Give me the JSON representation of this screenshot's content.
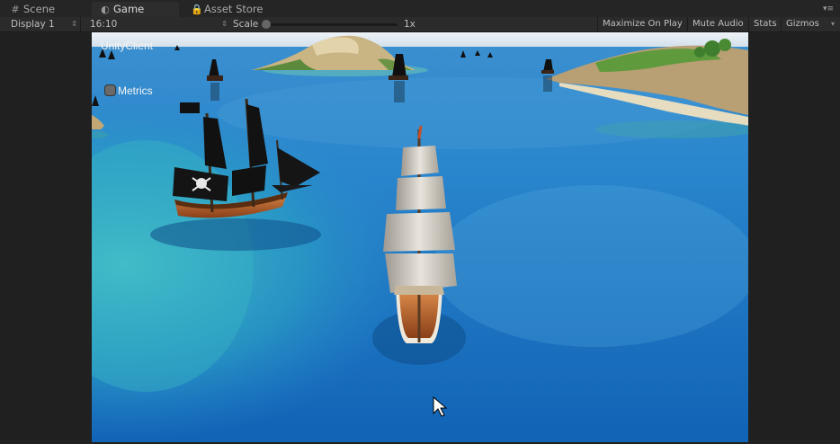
{
  "tabs": [
    {
      "label": "Scene",
      "icon": "grid-icon"
    },
    {
      "label": "Game",
      "icon": "pacman-icon"
    },
    {
      "label": "Asset Store",
      "icon": "lock-icon"
    }
  ],
  "toolbar": {
    "display": "Display 1",
    "aspect": "16:10",
    "scale_label": "Scale",
    "scale_value": "1x",
    "maximize_on_play": "Maximize On Play",
    "mute_audio": "Mute Audio",
    "stats": "Stats",
    "gizmos": "Gizmos"
  },
  "overlay": {
    "title": "UnityClient",
    "metrics_label": "Metrics"
  },
  "colors": {
    "sea": "#1d7fc8",
    "shallow": "#3fb7c9",
    "sky": "#d9e4ee"
  }
}
